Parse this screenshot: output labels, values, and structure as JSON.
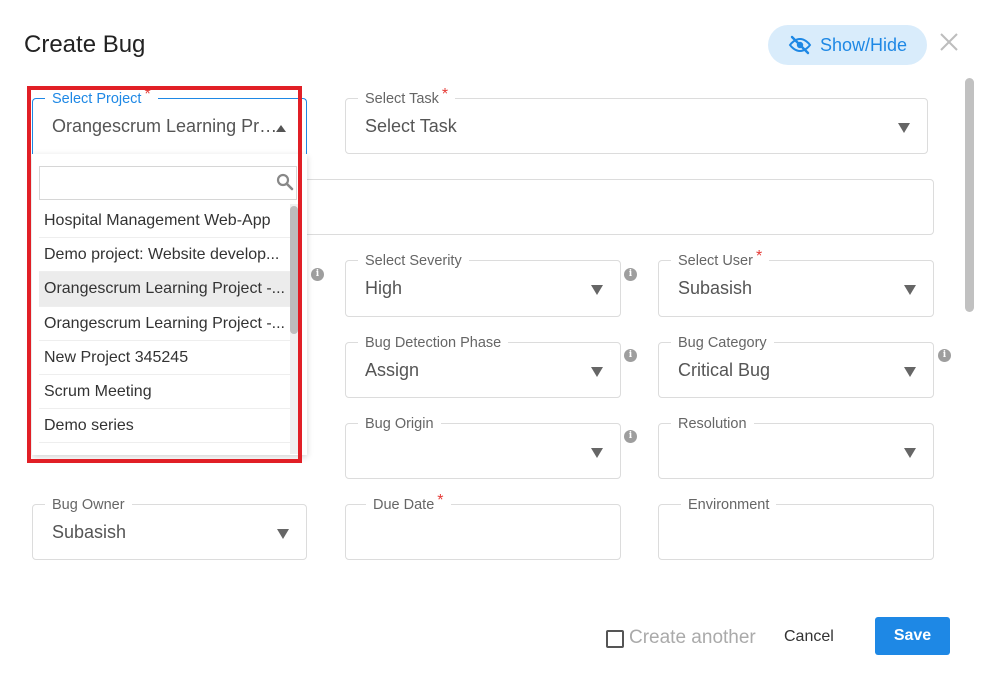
{
  "dialog": {
    "title": "Create Bug",
    "show_hide_label": "Show/Hide"
  },
  "fields": {
    "select_project": {
      "label": "Select Project",
      "value": "Orangescrum Learning Proje..",
      "required": true
    },
    "select_task": {
      "label": "Select Task",
      "value": "Select Task",
      "required": true
    },
    "select_severity": {
      "label": "Select Severity",
      "value": "High"
    },
    "select_user": {
      "label": "Select User",
      "value": "Subasish",
      "required": true
    },
    "bug_detection_phase": {
      "label": "Bug Detection Phase",
      "value": "Assign"
    },
    "bug_category": {
      "label": "Bug Category",
      "value": "Critical Bug"
    },
    "bug_origin": {
      "label": "Bug Origin",
      "value": ""
    },
    "resolution": {
      "label": "Resolution",
      "value": ""
    },
    "bug_owner": {
      "label": "Bug Owner",
      "value": "Subasish"
    },
    "due_date": {
      "label": "Due Date",
      "value": "",
      "required": true
    },
    "environment": {
      "label": "Environment",
      "value": ""
    }
  },
  "project_dropdown": {
    "search_value": "",
    "items": [
      "Hospital Management Web-App",
      "Demo project: Website develop...",
      "Orangescrum Learning Project -...",
      "Orangescrum Learning Project -...",
      "New Project 345245",
      "Scrum Meeting",
      "Demo series"
    ],
    "highlighted_index": 2
  },
  "footer": {
    "create_another_label": "Create another",
    "create_another_checked": false,
    "cancel_label": "Cancel",
    "save_label": "Save"
  },
  "required_marker": "*",
  "info_marker": "i",
  "colors": {
    "accent": "#1e88e5",
    "required": "#e53935",
    "highlight_box": "#e11f26",
    "show_hide_bg": "#d9ecfb"
  }
}
